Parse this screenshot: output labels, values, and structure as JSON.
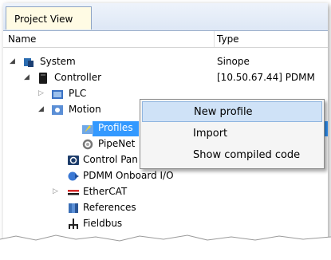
{
  "tab": {
    "label": "Project View"
  },
  "columns": {
    "name": "Name",
    "type": "Type"
  },
  "tree": {
    "system": {
      "label": "System",
      "type": "Sinope"
    },
    "controller": {
      "label": "Controller",
      "type": "[10.50.67.44] PDMM"
    },
    "plc": {
      "label": "PLC"
    },
    "motion": {
      "label": "Motion"
    },
    "profiles": {
      "label": "Profiles"
    },
    "pipenet": {
      "label": "PipeNet"
    },
    "control_panel": {
      "label": "Control Pan"
    },
    "pdmm_io": {
      "label": "PDMM Onboard I/O"
    },
    "ethercat": {
      "label": "EtherCAT"
    },
    "references": {
      "label": "References"
    },
    "fieldbus": {
      "label": "Fieldbus"
    }
  },
  "context_menu": {
    "items": [
      "New profile",
      "Import",
      "Show compiled code"
    ]
  },
  "colors": {
    "selection": "#3399ff",
    "menu_highlight": "#cfe2f7"
  }
}
